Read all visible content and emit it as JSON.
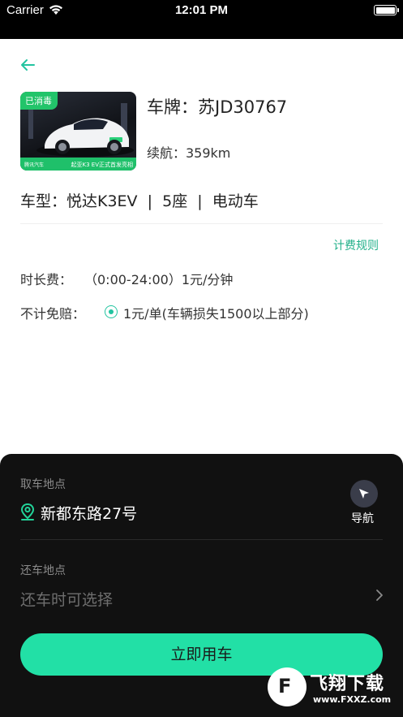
{
  "status_bar": {
    "carrier": "Carrier",
    "time": "12:01 PM",
    "wifi_icon": "wifi-icon",
    "battery_icon": "battery-icon"
  },
  "header": {
    "back_icon": "arrow-left-icon"
  },
  "car": {
    "photo_badge": "已消毒",
    "photo_caption": "起亚K3 EV正式首发亮相",
    "photo_brand": "腾讯汽车",
    "plate": "车牌：苏JD30767",
    "range": "续航：359km",
    "model": "车型：悦达K3EV  |  5座  |  电动车"
  },
  "pricing": {
    "rules_link": "计费规则",
    "time_fee_label": "时长费：",
    "time_fee_value": "（0:00-24:00）1元/分钟",
    "insurance_label": "不计免赔：",
    "insurance_value": "1元/单(车辆损失1500以上部分)",
    "insurance_selected": true
  },
  "pickup": {
    "label": "取车地点",
    "address": "新都东路27号",
    "nav_label": "导航",
    "pin_icon": "location-pin-icon",
    "nav_icon": "navigation-arrow-icon"
  },
  "return": {
    "label": "还车地点",
    "placeholder": "还车时可选择",
    "chevron_icon": "chevron-right-icon"
  },
  "action": {
    "use_car_label": "立即用车"
  },
  "watermark": {
    "title": "飞翔下载",
    "url": "www.FXXZ.com"
  },
  "colors": {
    "accent": "#22e0a6",
    "link": "#22b08a",
    "badge_green": "#22c46a",
    "panel_bg": "#111111"
  }
}
